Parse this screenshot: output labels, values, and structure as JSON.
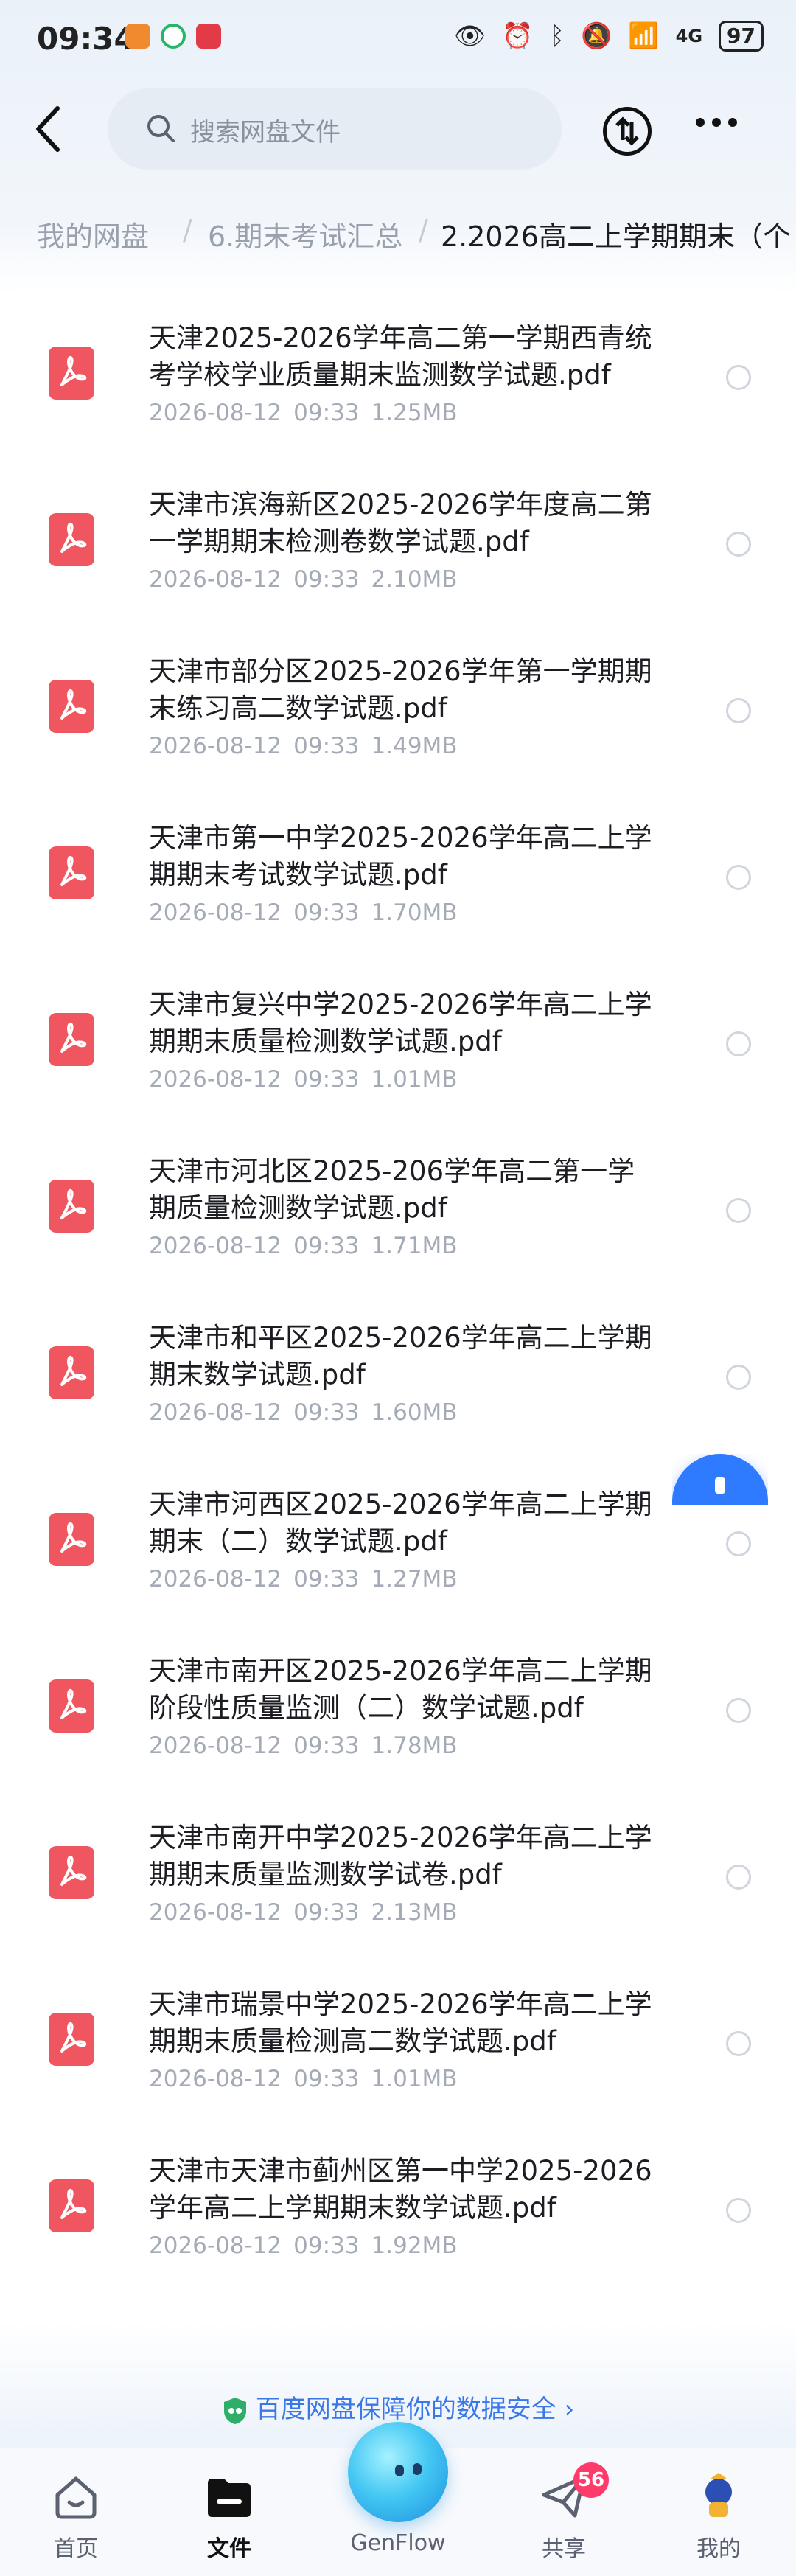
{
  "status_bar": {
    "time": "09:34",
    "network": "4G",
    "battery": "97"
  },
  "search": {
    "placeholder": "搜索网盘文件"
  },
  "breadcrumb": {
    "root": "我的网盘",
    "parent": "6.期末考试汇总",
    "current": "2.2026高二上学期期末（个"
  },
  "files": [
    {
      "line1": "天津2025-2026学年高二第一学期西青统",
      "line2": "考学校学业质量期末监测数学试题.pdf",
      "date": "2026-08-12",
      "time": "09:33",
      "size": "1.25MB"
    },
    {
      "line1": "天津市滨海新区2025-2026学年度高二第",
      "line2": "一学期期末检测卷数学试题.pdf",
      "date": "2026-08-12",
      "time": "09:33",
      "size": "2.10MB"
    },
    {
      "line1": "天津市部分区2025-2026学年第一学期期",
      "line2": "末练习高二数学试题.pdf",
      "date": "2026-08-12",
      "time": "09:33",
      "size": "1.49MB"
    },
    {
      "line1": "天津市第一中学2025-2026学年高二上学",
      "line2": "期期末考试数学试题.pdf",
      "date": "2026-08-12",
      "time": "09:33",
      "size": "1.70MB"
    },
    {
      "line1": "天津市复兴中学2025-2026学年高二上学",
      "line2": "期期末质量检测数学试题.pdf",
      "date": "2026-08-12",
      "time": "09:33",
      "size": "1.01MB"
    },
    {
      "line1": "天津市河北区2025-206学年高二第一学",
      "line2": "期质量检测数学试题.pdf",
      "date": "2026-08-12",
      "time": "09:33",
      "size": "1.71MB"
    },
    {
      "line1": "天津市和平区2025-2026学年高二上学期",
      "line2": "期末数学试题.pdf",
      "date": "2026-08-12",
      "time": "09:33",
      "size": "1.60MB"
    },
    {
      "line1": "天津市河西区2025-2026学年高二上学期",
      "line2": "期末（二）数学试题.pdf",
      "date": "2026-08-12",
      "time": "09:33",
      "size": "1.27MB"
    },
    {
      "line1": "天津市南开区2025-2026学年高二上学期",
      "line2": "阶段性质量监测（二）数学试题.pdf",
      "date": "2026-08-12",
      "time": "09:33",
      "size": "1.78MB"
    },
    {
      "line1": "天津市南开中学2025-2026学年高二上学",
      "line2": "期期末质量监测数学试卷.pdf",
      "date": "2026-08-12",
      "time": "09:33",
      "size": "2.13MB"
    },
    {
      "line1": "天津市瑞景中学2025-2026学年高二上学",
      "line2": "期期末质量检测高二数学试题.pdf",
      "date": "2026-08-12",
      "time": "09:33",
      "size": "1.01MB"
    },
    {
      "line1": "天津市天津市蓟州区第一中学2025-2026",
      "line2": "学年高二上学期期末数学试题.pdf",
      "date": "2026-08-12",
      "time": "09:33",
      "size": "1.92MB"
    }
  ],
  "safety_note": "百度网盘保障你的数据安全",
  "tabs": {
    "home": "首页",
    "files": "文件",
    "genflow": "GenFlow",
    "share": "共享",
    "share_badge": "56",
    "mine": "我的"
  },
  "colors": {
    "accent": "#2f7bff",
    "pdf_red": "#f0565f",
    "badge": "#ff3b6b"
  }
}
